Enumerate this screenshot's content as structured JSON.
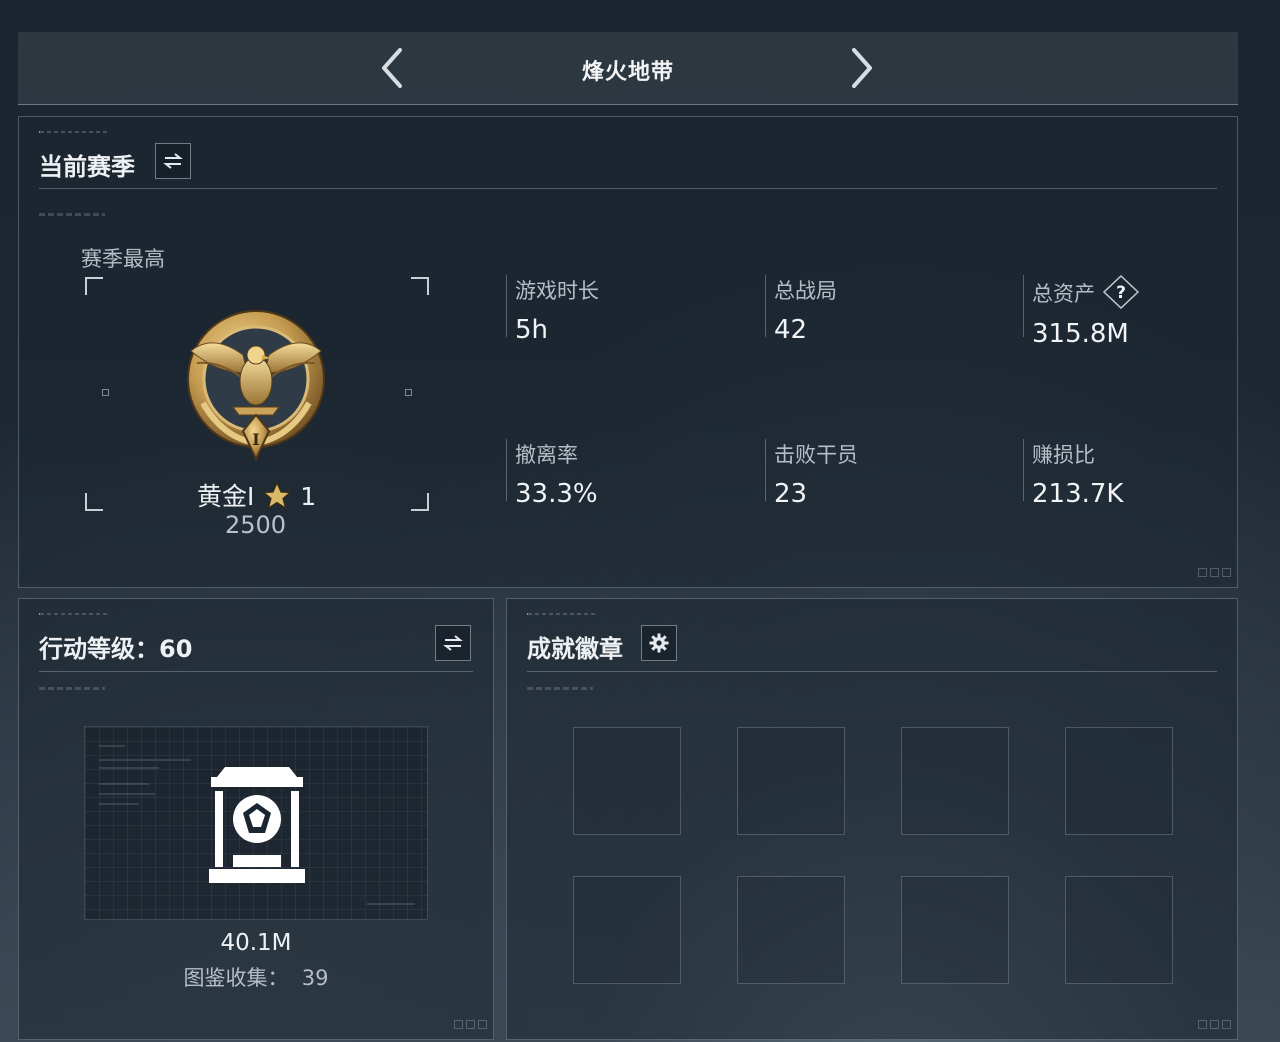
{
  "header": {
    "title": "烽火地带",
    "prev_icon": "chevron-left-icon",
    "next_icon": "chevron-right-icon"
  },
  "season": {
    "title": "当前赛季",
    "swap_icon": "swap-icon",
    "highest_label": "赛季最高",
    "rank_name": "黄金I",
    "rank_stars": "1",
    "rank_score": "2500",
    "stats": [
      {
        "label": "游戏时长",
        "value": "5h"
      },
      {
        "label": "总战局",
        "value": "42"
      },
      {
        "label": "总资产",
        "value": "315.8M",
        "help_icon": "question-icon"
      },
      {
        "label": "撤离率",
        "value": "33.3%"
      },
      {
        "label": "击败干员",
        "value": "23"
      },
      {
        "label": "赚损比",
        "value": "213.7K"
      }
    ]
  },
  "action_level": {
    "title": "行动等级：60",
    "swap_icon": "swap-icon",
    "value": "40.1M",
    "collection_text": "图鉴收集：  39"
  },
  "achievements": {
    "title": "成就徽章",
    "settings_icon": "gear-icon",
    "slots": 8
  },
  "colors": {
    "background": "#1e2833",
    "panel_border": "#8c9ba8",
    "gold": "#c9a45a",
    "text": "#e6eaee"
  }
}
